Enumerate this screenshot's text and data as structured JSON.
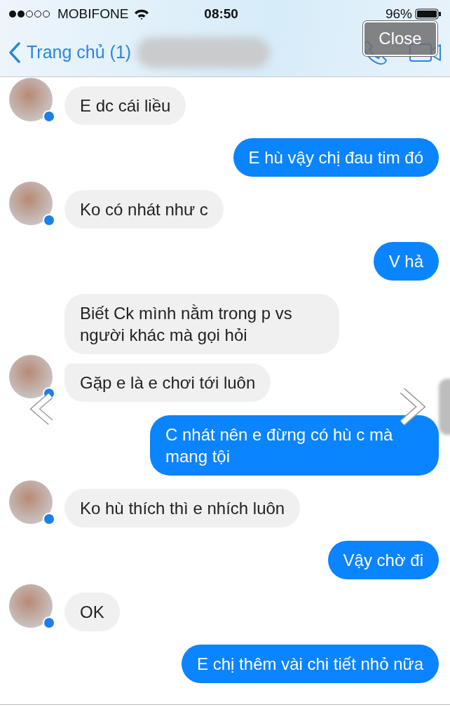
{
  "status_bar": {
    "carrier": "MOBIFONE",
    "time": "08:50",
    "battery": "96%"
  },
  "nav": {
    "back_label": "Trang chủ (1)"
  },
  "viewer": {
    "close": "Close"
  },
  "messages": [
    {
      "kind": "incoming",
      "text": "E dc cái liều",
      "avatar": true,
      "continued": false
    },
    {
      "kind": "outgoing",
      "text": "E hù vậy chị đau tim đó"
    },
    {
      "kind": "incoming",
      "text": "Ko có nhát như c",
      "avatar": true,
      "continued": false
    },
    {
      "kind": "outgoing",
      "text": "V hả"
    },
    {
      "kind": "incoming",
      "text": "Biết Ck mình nằm trong p vs người khác mà gọi hỏi",
      "avatar": false,
      "continued": false
    },
    {
      "kind": "incoming",
      "text": "Gặp e là e chơi tới luôn",
      "avatar": true,
      "continued": true
    },
    {
      "kind": "outgoing",
      "text": "C nhát nên e đừng có hù c mà mang tội"
    },
    {
      "kind": "incoming",
      "text": "Ko hù thích thì e nhích luôn",
      "avatar": true,
      "continued": false
    },
    {
      "kind": "outgoing",
      "text": "Vậy chờ đi"
    },
    {
      "kind": "incoming",
      "text": "OK",
      "avatar": true,
      "continued": false
    },
    {
      "kind": "outgoing",
      "text": "E chị thêm vài chi tiết nhỏ nữa"
    }
  ]
}
